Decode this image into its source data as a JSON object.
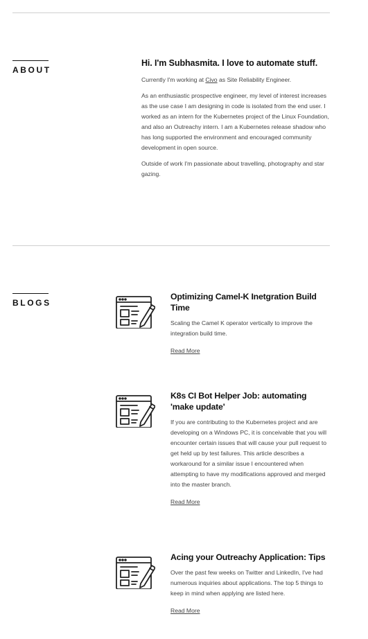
{
  "about": {
    "section_label": "ABOUT",
    "heading": "Hi. I'm Subhasmita. I love to automate stuff.",
    "p1_prefix": "Currently I'm working at ",
    "p1_link": "Civo",
    "p1_suffix": " as Site Reliability Engineer.",
    "p2": "As an enthusiastic prospective engineer, my level of interest increases as the use case I am designing in code is isolated from the end user. I worked as an intern for the Kubernetes project of the Linux Foundation, and also an Outreachy intern. I am a Kubernetes release shadow who has long supported the environment and encouraged community development in open source.",
    "p3": "Outside of work I'm passionate about travelling, photography and star gazing."
  },
  "blogs": {
    "section_label": "BLOGS",
    "icon": "blog-post-edit-icon",
    "items": [
      {
        "title": "Optimizing Camel-K Inetgration Build Time",
        "summary": "Scaling the Camel K operator vertically to improve the integration build time.",
        "link": "Read More"
      },
      {
        "title": "K8s CI Bot Helper Job: automating 'make update'",
        "summary": "If you are contributing to the Kubernetes project and are developing on a Windows PC, it is conceivable that you will encounter certain issues that will cause your pull request to get held up by test failures. This article describes a workaround for a similar issue I encountered when attempting to have my modifications approved and merged into the master branch.",
        "link": "Read More"
      },
      {
        "title": "Acing your Outreachy Application: Tips",
        "summary": "Over the past few weeks on Twitter and LinkedIn, I've had numerous inquiries about applications. The top 5 things to keep in mind when applying are listed here.",
        "link": "Read More"
      }
    ]
  }
}
